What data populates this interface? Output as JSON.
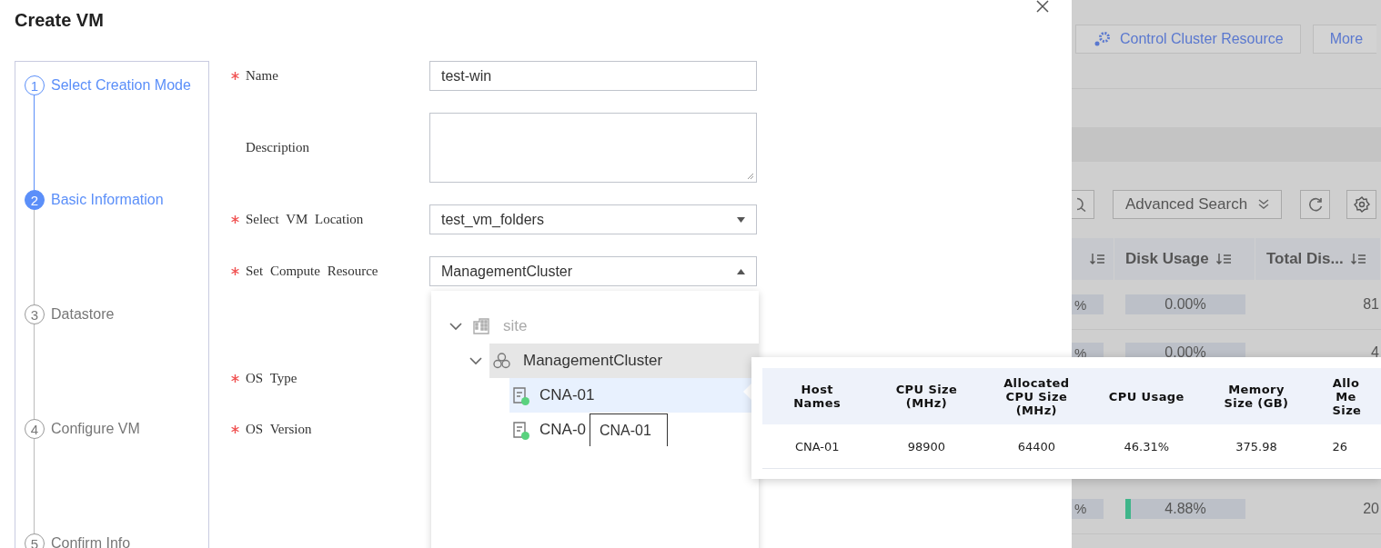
{
  "dialog": {
    "title": "Create VM"
  },
  "steps": [
    {
      "number": "1",
      "label": "Select Creation Mode",
      "done": true,
      "current": false
    },
    {
      "number": "2",
      "label": "Basic Information",
      "done": false,
      "current": true
    },
    {
      "number": "3",
      "label": "Datastore",
      "done": false,
      "current": false
    },
    {
      "number": "4",
      "label": "Configure VM",
      "done": false,
      "current": false
    },
    {
      "number": "5",
      "label": "Confirm Info",
      "done": false,
      "current": false
    }
  ],
  "form": [
    {
      "label": "Name",
      "required": true,
      "kind": "input",
      "value": "test-win"
    },
    {
      "label": "Description",
      "required": false,
      "kind": "textarea"
    },
    {
      "label": "Select VM Location",
      "required": true,
      "kind": "select",
      "value": "test_vm_folders",
      "open": false
    },
    {
      "label": "Set Compute Resource",
      "required": true,
      "kind": "select",
      "value": "ManagementCluster",
      "open": true
    },
    {
      "label": "OS Type",
      "required": true,
      "kind": "covered"
    },
    {
      "label": "OS Version",
      "required": true,
      "kind": "covered"
    }
  ],
  "resource_tree": [
    {
      "name": "site",
      "kind": "site",
      "expanded": true,
      "disabled": true,
      "selected": false,
      "hovered": false,
      "children": [
        {
          "name": "ManagementCluster",
          "kind": "cluster",
          "expanded": true,
          "disabled": false,
          "selected": true,
          "hovered": false,
          "children": [
            {
              "name": "CNA-01",
              "kind": "host",
              "disabled": false,
              "selected": false,
              "hovered": true,
              "color": "#5ad27e"
            },
            {
              "name": "CNA-0",
              "kind": "host",
              "disabled": false,
              "selected": false,
              "hovered": false,
              "color": "#5ad27e"
            }
          ]
        }
      ]
    }
  ],
  "tooltip": {
    "text": "CNA-01"
  },
  "host_details": {
    "columns": [
      "Host Names",
      "CPU Size (MHz)",
      "Allocated CPU Size (MHz)",
      "CPU Usage",
      "Memory Size (GB)",
      "Allo Me Size"
    ],
    "rows": [
      [
        "CNA-01",
        "98900",
        "64400",
        "46.31%",
        "375.98",
        "26"
      ]
    ]
  },
  "background": {
    "buttons": [
      "Control Cluster Resource",
      "More"
    ],
    "advanced_search": "Advanced Search",
    "columns": [
      "Disk Usage",
      "Total Dis..."
    ],
    "rows": [
      {
        "column_1": "%",
        "disk_usage": "0.00%",
        "level": 0,
        "total": "81"
      },
      {
        "column_1": "%",
        "disk_usage": "0.00%",
        "level": 0,
        "total": "4"
      },
      {
        "column_1": "%",
        "disk_usage": "4.88%",
        "level": 0.0488,
        "total": "20"
      }
    ]
  }
}
